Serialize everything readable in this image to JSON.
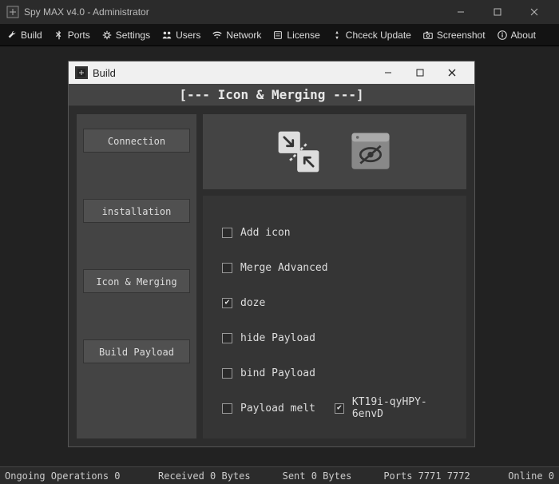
{
  "window": {
    "title": "Spy MAX v4.0 - Administrator"
  },
  "toolbar": {
    "items": [
      {
        "id": "build",
        "label": "Build"
      },
      {
        "id": "ports",
        "label": "Ports"
      },
      {
        "id": "settings",
        "label": "Settings"
      },
      {
        "id": "users",
        "label": "Users"
      },
      {
        "id": "network",
        "label": "Network"
      },
      {
        "id": "license",
        "label": "License"
      },
      {
        "id": "chceck-update",
        "label": "Chceck Update"
      },
      {
        "id": "screenshot",
        "label": "Screenshot"
      },
      {
        "id": "about",
        "label": "About"
      }
    ]
  },
  "build_window": {
    "title": "Build",
    "header": "[--- Icon & Merging ---]",
    "sidebar": [
      {
        "id": "connection",
        "label": "Connection"
      },
      {
        "id": "installation",
        "label": "installation"
      },
      {
        "id": "icon-merging",
        "label": "Icon & Merging"
      },
      {
        "id": "build-payload",
        "label": "Build Payload"
      }
    ],
    "options": [
      {
        "id": "add-icon",
        "label": "Add icon",
        "checked": false,
        "fullrow": true
      },
      {
        "id": "merge-advanced",
        "label": "Merge Advanced",
        "checked": false,
        "fullrow": true
      },
      {
        "id": "doze",
        "label": "doze",
        "checked": true,
        "fullrow": true
      },
      {
        "id": "hide-payload",
        "label": "hide Payload",
        "checked": false,
        "fullrow": true
      },
      {
        "id": "bind-payload",
        "label": "bind Payload",
        "checked": false,
        "fullrow": true
      },
      {
        "id": "payload-melt",
        "label": "Payload melt",
        "checked": false,
        "fullrow": false
      },
      {
        "id": "kt19i",
        "label": "KT19i-qyHPY-6envD",
        "checked": true,
        "fullrow": false
      }
    ]
  },
  "statusbar": {
    "ongoing": "Ongoing Operations 0",
    "received": "Received 0 Bytes",
    "sent": "Sent 0 Bytes",
    "ports": "Ports 7771 7772",
    "online": "Online 0"
  }
}
